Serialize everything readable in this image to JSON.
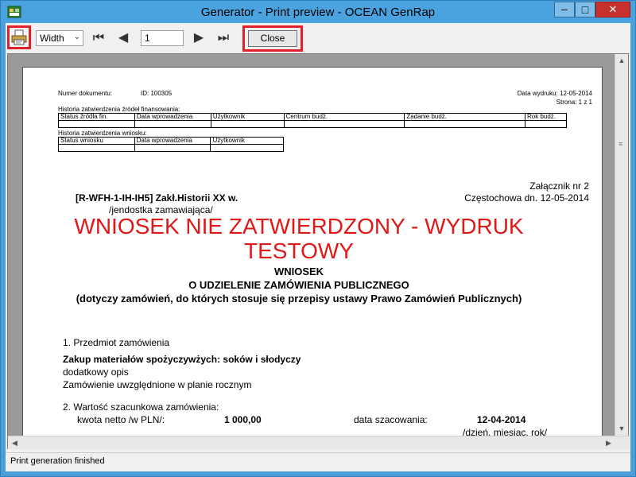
{
  "window": {
    "title": "Generator  - Print preview - OCEAN GenRap",
    "min_glyph": "–",
    "max_glyph": "□",
    "close_glyph": "✕"
  },
  "toolbar": {
    "zoom_value": "Width",
    "page_value": "1",
    "close_label": "Close"
  },
  "status": {
    "text": "Print generation finished"
  },
  "document": {
    "doc_number_label": "Numer dokumentu:",
    "doc_number_value": "ID: 100305",
    "print_date": "Data wydruku: 12-05-2014",
    "page_info": "Strona: 1 z 1",
    "history1_title": "Historia zatwierdzenia źródeł finansowania:",
    "history1_headers": [
      "Status źródła fin.",
      "Data wprowadzenia",
      "Użytkownik",
      "Centrum budż.",
      "Zadanie budż.",
      "Rok budż."
    ],
    "history2_title": "Historia zatwierdzenia wniosku:",
    "history2_headers": [
      "Status wniosku",
      "Data wprowadzenia",
      "Użytkownik"
    ],
    "attachment": "Załącznik nr 2",
    "unit_name": "[R-WFH-1-IH-IH5] Zakł.Historii XX w.",
    "city_date": "Częstochowa dn. 12-05-2014",
    "unit_caption": "/jendostka zamawiająca/",
    "red_title_line1": "WNIOSEK NIE ZATWIERDZONY - WYDRUK",
    "red_title_line2": "TESTOWY",
    "heading1": "WNIOSEK",
    "heading2": "O UDZIELENIE ZAMÓWIENIA PUBLICZNEGO",
    "heading3": "(dotyczy zamówień, do których stosuje się przepisy ustawy Prawo Zamówień Publicznych)",
    "section1_title": "1.  Przedmiot zamówienia",
    "section1_subject": "Zakup materiałów spożyczywżych: soków i słodyczy",
    "section1_extra": "dodatkowy opis",
    "section1_plan": "Zamówienie uwzględnione w planie rocznym",
    "section2_title": "2.  Wartość szacunkowa zamówienia:",
    "net_label": "kwota netto /w PLN/:",
    "net_value": "1 000,00",
    "estimate_label": "data szacowania:",
    "estimate_date": "12-04-2014",
    "date_caption": "/dzień, miesiąc, rok/"
  }
}
